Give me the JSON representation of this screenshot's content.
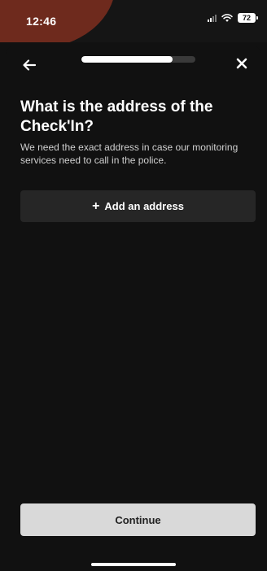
{
  "status_bar": {
    "time": "12:46",
    "battery": "72",
    "accent_color": "#6e2a1d"
  },
  "header": {
    "back_icon": "arrow-left-icon",
    "close_icon": "close-icon",
    "progress": 0.8
  },
  "content": {
    "title": "What is the address of the Check'In?",
    "subtitle": "We need the exact address in case our monitoring services need to call in the police.",
    "add_address": {
      "icon_text": "+",
      "label": "Add an address"
    }
  },
  "footer": {
    "continue_label": "Continue"
  },
  "colors": {
    "background": "#111111",
    "surface": "#262626",
    "primary_button": "#d9d9d9"
  }
}
